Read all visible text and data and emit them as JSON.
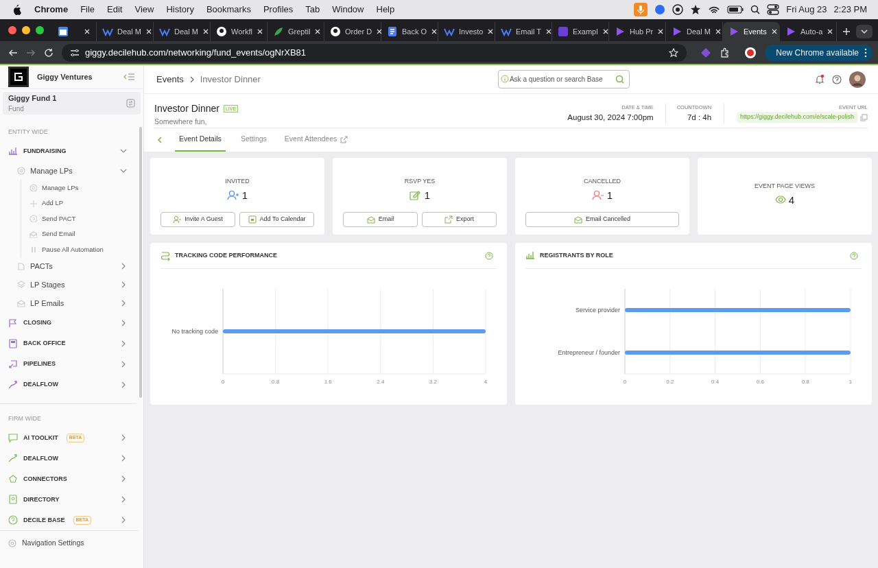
{
  "menu_bar": {
    "app": "Chrome",
    "menus": [
      "File",
      "Edit",
      "View",
      "History",
      "Bookmarks",
      "Profiles",
      "Tab",
      "Window",
      "Help"
    ],
    "date": "Fri Aug 23",
    "time": "2:23 PM"
  },
  "browser": {
    "tabs": [
      {
        "selected": false
      },
      {
        "title": "Deal M",
        "selected": false
      },
      {
        "title": "Deal M",
        "selected": false
      },
      {
        "title": "Workfl",
        "selected": false
      },
      {
        "title": "Greptil",
        "selected": false
      },
      {
        "title": "Order D",
        "selected": false
      },
      {
        "title": "Back O",
        "selected": false
      },
      {
        "title": "Investo",
        "selected": false
      },
      {
        "title": "Email T",
        "selected": false
      },
      {
        "title": "Exampl",
        "selected": false
      },
      {
        "title": "Hub Pr",
        "selected": false
      },
      {
        "title": "Deal M",
        "selected": false
      },
      {
        "title": "Events",
        "selected": true
      },
      {
        "title": "Auto-a",
        "selected": false
      }
    ],
    "url": "giggy.decilehub.com/networking/fund_events/ogNrXB81",
    "update_button": "New Chrome available"
  },
  "sidebar": {
    "org": "Giggy Ventures",
    "fund": {
      "name": "Giggy Fund 1",
      "type": "Fund"
    },
    "sections": [
      {
        "heading": "ENTITY WIDE",
        "items": [
          {
            "label": "FUNDRAISING",
            "expanded": true,
            "children": [
              {
                "label": "Manage LPs",
                "expanded": true,
                "children": [
                  {
                    "label": "Manage LPs"
                  },
                  {
                    "label": "Add LP"
                  },
                  {
                    "label": "Send PACT"
                  },
                  {
                    "label": "Send Email"
                  },
                  {
                    "label": "Pause All Automation"
                  }
                ]
              },
              {
                "label": "PACTs",
                "expanded": false
              },
              {
                "label": "LP Stages",
                "expanded": false
              },
              {
                "label": "LP Emails",
                "expanded": false
              }
            ]
          },
          {
            "label": "CLOSING",
            "expanded": false
          },
          {
            "label": "BACK OFFICE",
            "expanded": false
          },
          {
            "label": "PIPELINES",
            "expanded": false
          },
          {
            "label": "DEALFLOW",
            "expanded": false
          }
        ]
      },
      {
        "heading": "FIRM WIDE",
        "items": [
          {
            "label": "AI TOOLKIT",
            "badge": "BETA",
            "expanded": false
          },
          {
            "label": "DEALFLOW",
            "expanded": false
          },
          {
            "label": "CONNECTORS",
            "expanded": false
          },
          {
            "label": "DIRECTORY",
            "expanded": false
          },
          {
            "label": "DECILE BASE",
            "badge": "BETA",
            "expanded": false
          }
        ]
      }
    ],
    "footer": "Navigation Settings"
  },
  "header": {
    "breadcrumb": [
      "Events",
      "Investor Dinner"
    ],
    "search": {
      "placeholder": "Ask a question or search Base"
    }
  },
  "event": {
    "title": "Investor Dinner",
    "badge": "LIVE",
    "location": "Somewhere fun,",
    "details": [
      {
        "label": "DATE & TIME",
        "value": "August 30, 2024 7:00pm"
      },
      {
        "label": "COUNTDOWN",
        "value": "7d : 4h"
      }
    ],
    "url_label": "EVENT URL",
    "url": "https://giggy.decilehub.com/e/scale-polish",
    "tabs": [
      {
        "label": "Event Details",
        "selected": true
      },
      {
        "label": "Settings",
        "selected": false
      },
      {
        "label": "Event Attendees",
        "selected": false
      }
    ]
  },
  "stats": [
    {
      "label": "INVITED",
      "value": "1",
      "buttons": [
        "Invite A Guest",
        "Add To Calendar"
      ]
    },
    {
      "label": "RSVP YES",
      "value": "1",
      "buttons": [
        "Email",
        "Export"
      ]
    },
    {
      "label": "CANCELLED",
      "value": "1",
      "buttons": [
        "Email Cancelled"
      ]
    },
    {
      "label": "EVENT PAGE VIEWS",
      "value": "4"
    }
  ],
  "charts": [
    {
      "title": "TRACKING CODE PERFORMANCE",
      "chart_data": {
        "type": "bar",
        "orientation": "horizontal",
        "categories": [
          "No tracking code"
        ],
        "values": [
          4
        ],
        "xlim": [
          0,
          4
        ],
        "grid": true,
        "xticks": [
          0,
          0.8,
          1.6,
          2.4,
          3.2,
          4
        ]
      }
    },
    {
      "title": "REGISTRANTS BY ROLE",
      "chart_data": {
        "type": "bar",
        "orientation": "horizontal",
        "categories": [
          "Service provider",
          "Entrepreneur / founder"
        ],
        "values": [
          1,
          1
        ],
        "xlim": [
          0,
          1
        ],
        "grid": true,
        "xticks": [
          0,
          0.2,
          0.4,
          0.6,
          0.8,
          1
        ]
      }
    }
  ]
}
